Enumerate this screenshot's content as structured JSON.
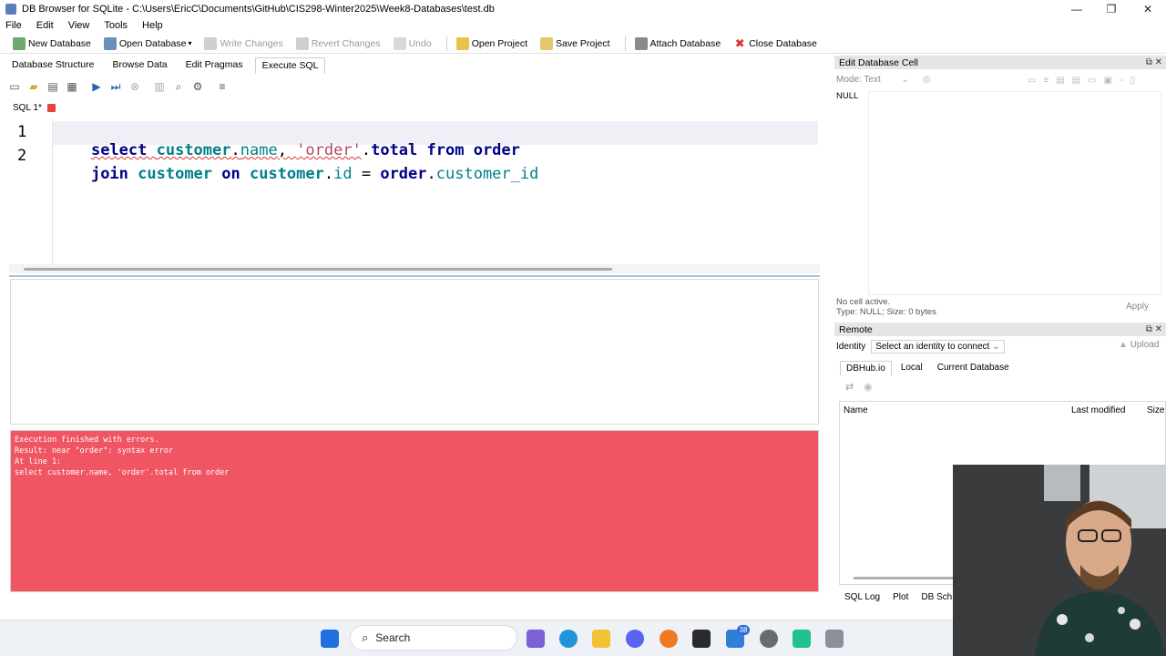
{
  "window": {
    "title": "DB Browser for SQLite - C:\\Users\\EricC\\Documents\\GitHub\\CIS298-Winter2025\\Week8-Databases\\test.db",
    "controls": [
      "—",
      "❐",
      "✕"
    ]
  },
  "menu": [
    "File",
    "Edit",
    "View",
    "Tools",
    "Help"
  ],
  "toolbar": {
    "new_database": "New Database",
    "open_database": "Open Database",
    "write_changes": "Write Changes",
    "revert_changes": "Revert Changes",
    "undo": "Undo",
    "open_project": "Open Project",
    "save_project": "Save Project",
    "attach_database": "Attach Database",
    "close_database": "Close Database"
  },
  "tabs": [
    "Database Structure",
    "Browse Data",
    "Edit Pragmas",
    "Execute SQL"
  ],
  "active_tab": "Execute SQL",
  "sql_tab_label": "SQL 1*",
  "editor": {
    "line_numbers": [
      "1",
      "2"
    ],
    "line1": {
      "t1": "select ",
      "t2": "customer",
      "t3": ".",
      "t4": "name",
      "t5": ", ",
      "t6": "'order'",
      "t7": ".",
      "t8": "total",
      "t9": " from ",
      "t10": "order"
    },
    "line2": {
      "t1": "join ",
      "t2": "customer",
      "t3": " on ",
      "t4": "customer",
      "t5": ".",
      "t6": "id",
      "t7": " = ",
      "t8": "order",
      "t9": ".",
      "t10": "customer_id"
    }
  },
  "error_message": [
    "Execution finished with errors.",
    "Result: near \"order\": syntax error",
    "At line 1:",
    "select customer.name, 'order'.total from order"
  ],
  "edit_cell": {
    "title": "Edit Database Cell",
    "mode": "Mode: Text",
    "value": "NULL",
    "status1": "No cell active.",
    "status2": "Type: NULL; Size: 0 bytes",
    "apply": "Apply"
  },
  "remote": {
    "title": "Remote",
    "identity_label": "Identity",
    "identity_value": "Select an identity to connect",
    "upload": "Upload",
    "tabs": [
      "DBHub.io",
      "Local",
      "Current Database"
    ],
    "columns": {
      "name": "Name",
      "last_modified": "Last modified",
      "size": "Size"
    }
  },
  "bottom_tabs": [
    "SQL Log",
    "Plot",
    "DB Sch"
  ],
  "taskbar": {
    "search": "Search",
    "badge": "38"
  },
  "colors": {
    "error_bg": "#f05564",
    "keyword": "#00008b",
    "identifier": "#00808a",
    "string": "#b04a5a"
  }
}
